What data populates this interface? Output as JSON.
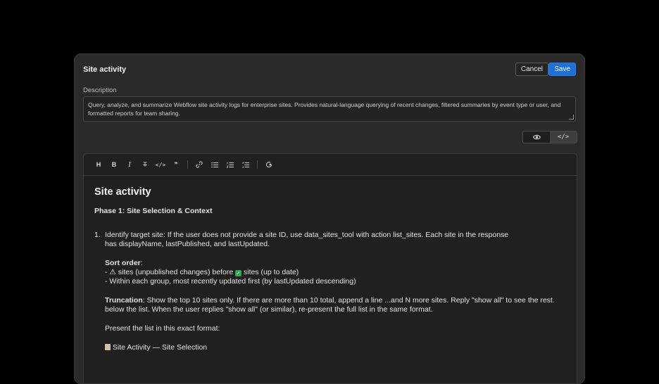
{
  "modal": {
    "title": "Site activity",
    "cancel_label": "Cancel",
    "save_label": "Save",
    "description_label": "Description",
    "description_value": "Query, analyze, and summarize Webflow site activity logs for enterprise sites. Provides natural-language querying of recent changes, filtered summaries by event type or user, and formatted reports for team sharing."
  },
  "toggle": {
    "code_label": "</>"
  },
  "toolbar": {
    "heading": "H",
    "bold": "B",
    "italic": "I",
    "strike": "T",
    "code": "</>",
    "quote": "❞"
  },
  "editor": {
    "h1": "Site activity",
    "phase_title": "Phase 1: Site Selection & Context",
    "item_num": "1.",
    "item_line1": "Identify target site: If the user does not provide a site ID, use data_sites_tool with action list_sites. Each site in the response",
    "item_line2": "has displayName, lastPublished, and lastUpdated.",
    "sort_order_label": "Sort order",
    "sort_colon": ":",
    "sort_dash1": "- ",
    "warn_icon": "⚠",
    "sort_line1_a": " sites (unpublished changes) before ",
    "check_icon": "✓",
    "sort_line1_b": " sites (up to date)",
    "sort_line2": "- Within each group, most recently updated first (by lastUpdated descending)",
    "truncation_label": "Truncation",
    "truncation_line1": ": Show the top 10 sites only. If there are more than 10 total, append a line ...and N more sites. Reply \"show all\" to see the rest.",
    "truncation_line2": "below the list. When the user replies \"show all\" (or similar), re-present the full list in the same format.",
    "present_line": "Present the list in this exact format:",
    "selection_heading": " Site Activity — Site Selection"
  }
}
